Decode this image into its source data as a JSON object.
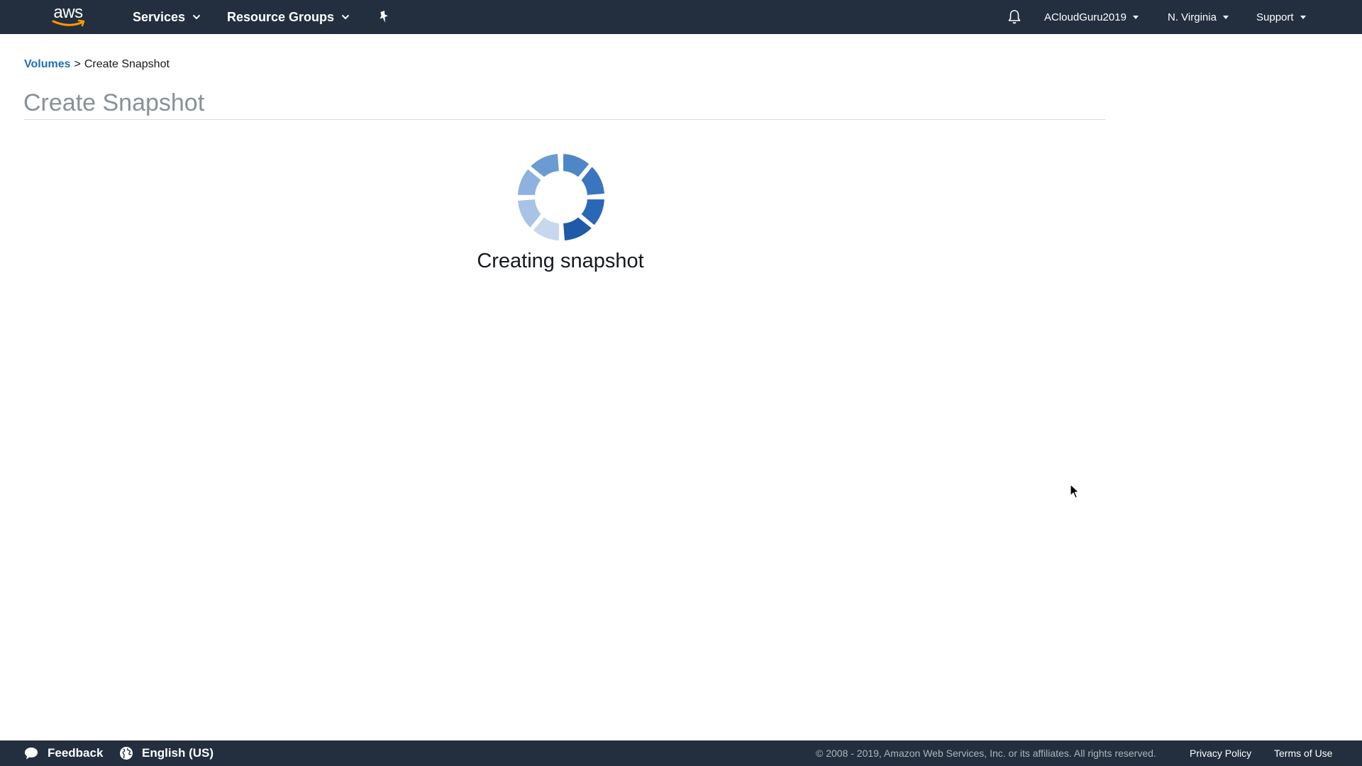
{
  "nav": {
    "logo_text": "aws",
    "services_label": "Services",
    "resource_groups_label": "Resource Groups",
    "pin_icon": "pushpin-icon",
    "bell_icon": "bell-icon",
    "account_label": "ACloudGuru2019",
    "region_label": "N. Virginia",
    "support_label": "Support"
  },
  "breadcrumb": {
    "link_label": "Volumes",
    "separator": ">",
    "current": "Create Snapshot"
  },
  "page": {
    "title": "Create Snapshot",
    "status_text": "Creating snapshot"
  },
  "footer": {
    "feedback_label": "Feedback",
    "language_label": "English (US)",
    "copyright": "© 2008 - 2019, Amazon Web Services, Inc. or its affiliates. All rights reserved.",
    "privacy_label": "Privacy Policy",
    "terms_label": "Terms of Use"
  },
  "colors": {
    "nav_background": "#232f3e",
    "link_blue": "#1f6fb4",
    "title_gray": "#879196",
    "spinner_blue": "#1f5fb0"
  }
}
